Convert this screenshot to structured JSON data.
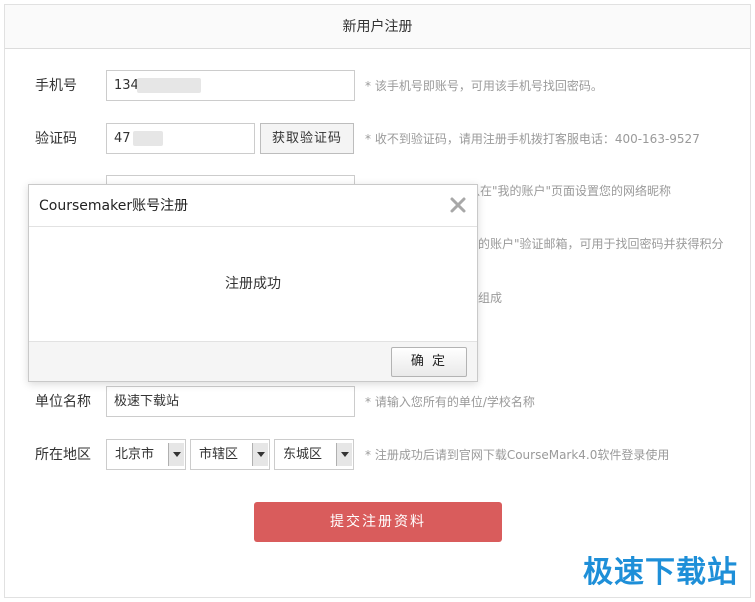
{
  "header": {
    "title": "新用户注册"
  },
  "form": {
    "phone": {
      "label": "手机号",
      "value": "134",
      "hint": "* 该手机号即账号，可用该手机号找回密码。"
    },
    "code": {
      "label": "验证码",
      "value": "47",
      "button": "获取验证码",
      "hint": "* 收不到验证码，请用注册手机拨打客服电话：400-163-9527"
    },
    "nickname": {
      "hint": "以在\"我的账户\"页面设置您的网络昵称"
    },
    "email": {
      "hint": "的账户\"验证邮箱，可用于找回密码并获得积分"
    },
    "password": {
      "hint": "组成"
    },
    "org": {
      "label": "单位名称",
      "value": "极速下载站",
      "hint": "* 请输入您所有的单位/学校名称"
    },
    "region": {
      "label": "所在地区",
      "province": "北京市",
      "city": "市辖区",
      "district": "东城区",
      "hint": "* 注册成功后请到官网下载CourseMark4.0软件登录使用"
    },
    "submit": "提交注册资料"
  },
  "modal": {
    "title": "Coursemaker账号注册",
    "message": "注册成功",
    "ok": "确 定"
  },
  "watermark": "极速下载站",
  "colors": {
    "submit": "#d95c5c",
    "watermark": "#1e8fd8",
    "hint": "#9a9a9a"
  },
  "icons": {
    "close": "close-icon",
    "dropdown": "chevron-down-icon"
  }
}
